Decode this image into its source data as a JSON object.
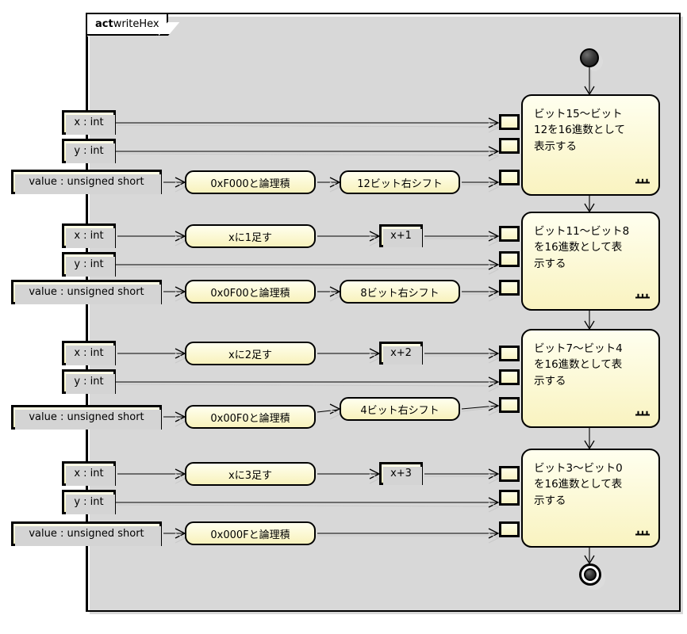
{
  "diagram": {
    "kind_keyword": "act",
    "name": "writeHex",
    "type": "uml-activity-diagram"
  },
  "nodes": {
    "start": {
      "name": "initial-node"
    },
    "end": {
      "name": "final-node"
    }
  },
  "rows": [
    {
      "id": "row1",
      "x_param": "x : int",
      "y_param": "y : int",
      "value_param": "value : unsigned short",
      "increment_action": null,
      "increment_result": null,
      "and_action": "0xF000と論理積",
      "shift_action": "12ビット右シフト",
      "activity": "ビット15〜ビット12を16進数として表示する",
      "activity_lines": [
        "ビット15〜ビット",
        "12を16進数として",
        "表示する"
      ]
    },
    {
      "id": "row2",
      "x_param": "x : int",
      "y_param": "y : int",
      "value_param": "value : unsigned short",
      "increment_action": "xに1足す",
      "increment_result": "x+1",
      "and_action": "0x0F00と論理積",
      "shift_action": "8ビット右シフト",
      "activity": "ビット11〜ビット8を16進数として表示する",
      "activity_lines": [
        "ビット11〜ビット8",
        "を16進数として表",
        "示する"
      ]
    },
    {
      "id": "row3",
      "x_param": "x : int",
      "y_param": "y : int",
      "value_param": "value : unsigned short",
      "increment_action": "xに2足す",
      "increment_result": "x+2",
      "and_action": "0x00F0と論理積",
      "shift_action": "4ビット右シフト",
      "activity": "ビット7〜ビット4を16進数として表示する",
      "activity_lines": [
        "ビット7〜ビット4",
        "を16進数として表",
        "示する"
      ]
    },
    {
      "id": "row4",
      "x_param": "x : int",
      "y_param": "y : int",
      "value_param": "value : unsigned short",
      "increment_action": "xに3足す",
      "increment_result": "x+3",
      "and_action": "0x000Fと論理積",
      "shift_action": null,
      "activity": "ビット3〜ビット0を16進数として表示する",
      "activity_lines": [
        "ビット3〜ビット0",
        "を16進数として表",
        "示する"
      ]
    }
  ],
  "colors": {
    "node_fill": "#fcf7c4",
    "node_fill_light": "#ffffef",
    "border": "#000000",
    "shadow": "#d8d8d8",
    "background": "#ffffff"
  }
}
